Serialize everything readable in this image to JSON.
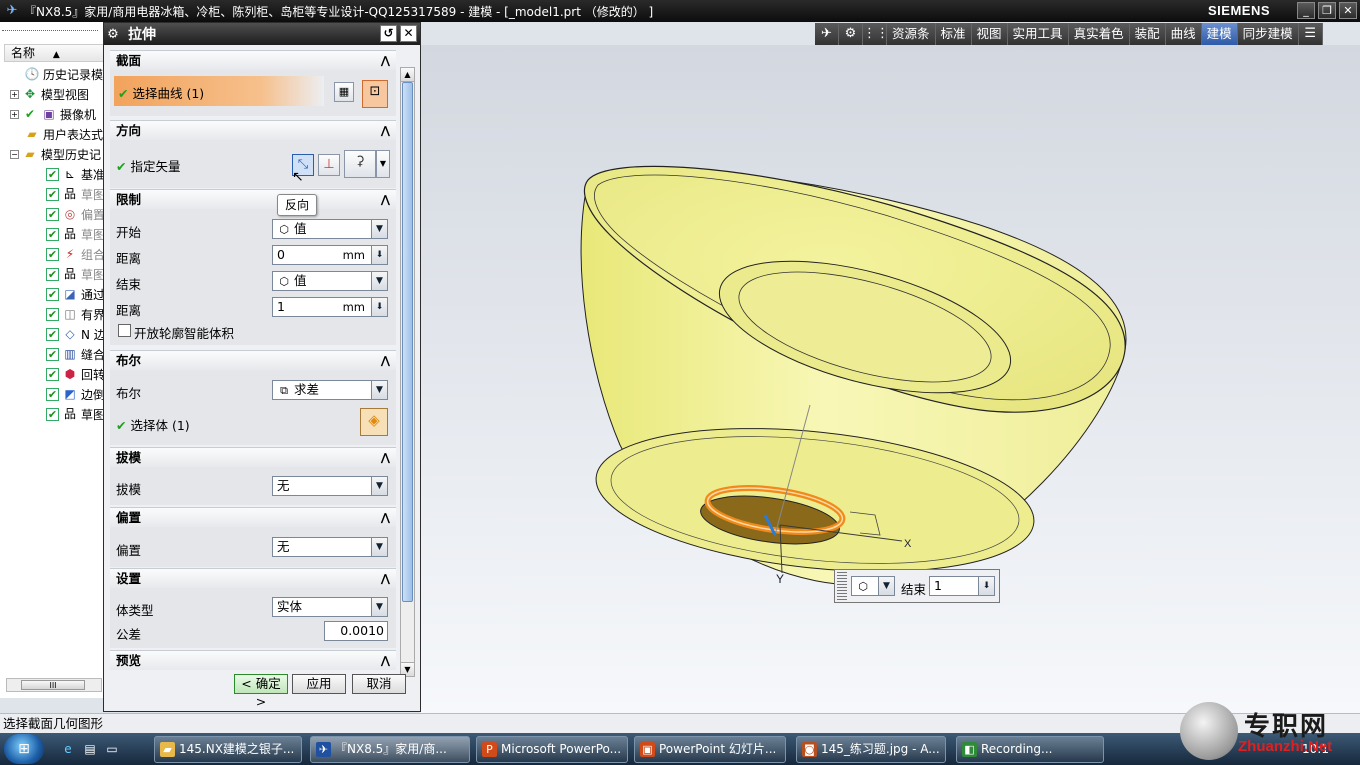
{
  "window": {
    "title": "『NX8.5』家用/商用电器冰箱、冷柜、陈列柜、岛柜等专业设计-QQ125317589 - 建模 - [_model1.prt （修改的） ]",
    "brand": "SIEMENS",
    "min": "_",
    "restore": "❐",
    "close": "✕"
  },
  "toolbar": {
    "items": [
      "资源条",
      "标准",
      "视图",
      "实用工具",
      "真实着色",
      "装配",
      "曲线",
      "建模",
      "同步建模"
    ],
    "active": "建模"
  },
  "navigator": {
    "column_header": "名称",
    "rows": [
      "历史记录模",
      "模型视图",
      "摄像机",
      "用户表达式",
      "模型历史记",
      "基准",
      "草图",
      "偏置",
      "草图",
      "组合",
      "草图",
      "通过",
      "有界",
      "N 边",
      "缝合",
      "回转",
      "边倒",
      "草图"
    ],
    "scroll_label": "III"
  },
  "dialog": {
    "title": "拉伸",
    "sections": {
      "section": "截面",
      "direction": "方向",
      "limits": "限制",
      "boolean": "布尔",
      "draft": "拔模",
      "offset": "偏置",
      "settings": "设置",
      "preview": "预览"
    },
    "select_curve": "选择曲线 (1)",
    "specify_vector": "指定矢量",
    "tooltip": "反向",
    "start_label": "开始",
    "start_value": "值",
    "distance_label": "距离",
    "start_distance": "0",
    "unit": "mm",
    "end_label": "结束",
    "end_value": "值",
    "end_distance": "1",
    "open_profile": "开放轮廓智能体积",
    "boolean_label": "布尔",
    "boolean_value": "求差",
    "select_body": "选择体 (1)",
    "draft_label": "拔模",
    "draft_value": "无",
    "offset_label": "偏置",
    "offset_value": "无",
    "body_type_label": "体类型",
    "body_type_value": "实体",
    "tolerance_label": "公差",
    "tolerance_value": "0.0010",
    "ok": "< 确定 >",
    "apply": "应用",
    "cancel": "取消"
  },
  "float_input": {
    "label": "结束",
    "value": "1"
  },
  "axes": {
    "x": "X",
    "y": "Y"
  },
  "status": "选择截面几何图形",
  "taskbar": {
    "tasks": [
      "145.NX建模之银子...",
      "『NX8.5』家用/商...",
      "Microsoft PowerPo...",
      "PowerPoint 幻灯片...",
      "145_练习题.jpg - A...",
      "Recording..."
    ],
    "clock": "10:1"
  },
  "watermark": {
    "cn": "专职网",
    "en": "Zhuanzhi.Net"
  },
  "colors": {
    "accent": "#3a64b8",
    "model": "#f2f199",
    "orange": "#f5a14a"
  }
}
